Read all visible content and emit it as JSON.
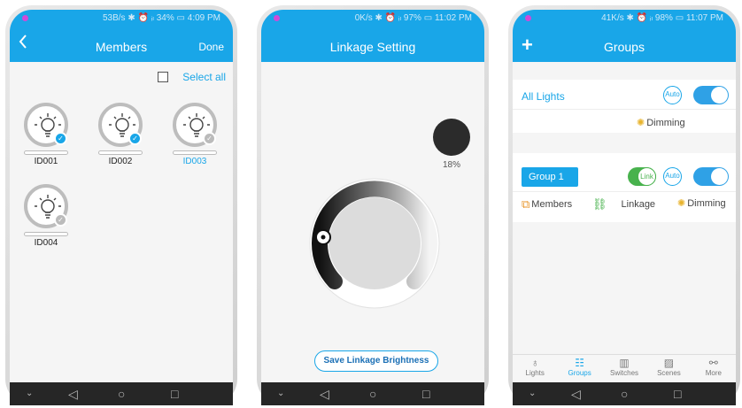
{
  "screen1": {
    "status": "53B/s ✱ ⏰ ᵢₗ 34% ▭ 4:09 PM",
    "back_icon": "chevron-left-icon",
    "title": "Members",
    "done_label": "Done",
    "select_all_label": "Select all",
    "members": [
      {
        "id": "ID001",
        "checked": true
      },
      {
        "id": "ID002",
        "checked": true
      },
      {
        "id": "ID003",
        "checked": false,
        "highlighted": true
      },
      {
        "id": "ID004",
        "checked": false
      }
    ]
  },
  "screen2": {
    "status": "0K/s ✱ ⏰ ᵢₗ 97% ▭ 11:02 PM",
    "title": "Linkage Setting",
    "brightness": "18%",
    "save_label": "Save Linkage Brightness"
  },
  "screen3": {
    "status": "41K/s ✱ ⏰ ᵢₗ 98% ▭ 11:07 PM",
    "add_icon": "plus-icon",
    "title": "Groups",
    "all_lights": {
      "label": "All Lights",
      "auto_label": "Auto",
      "dimming_label": "Dimming"
    },
    "group1": {
      "label": "Group 1",
      "link_label": "Link",
      "auto_label": "Auto",
      "members_label": "Members",
      "linkage_label": "Linkage",
      "dimming_label": "Dimming"
    },
    "tabs": [
      {
        "label": "Lights",
        "icon": "bulb-icon",
        "active": false
      },
      {
        "label": "Groups",
        "icon": "groups-icon",
        "active": true
      },
      {
        "label": "Switches",
        "icon": "switch-icon",
        "active": false
      },
      {
        "label": "Scenes",
        "icon": "scene-icon",
        "active": false
      },
      {
        "label": "More",
        "icon": "share-icon",
        "active": false
      }
    ]
  },
  "colors": {
    "accent": "#19a6e8",
    "link_green": "#48b24d",
    "nav_dark": "#262626"
  }
}
